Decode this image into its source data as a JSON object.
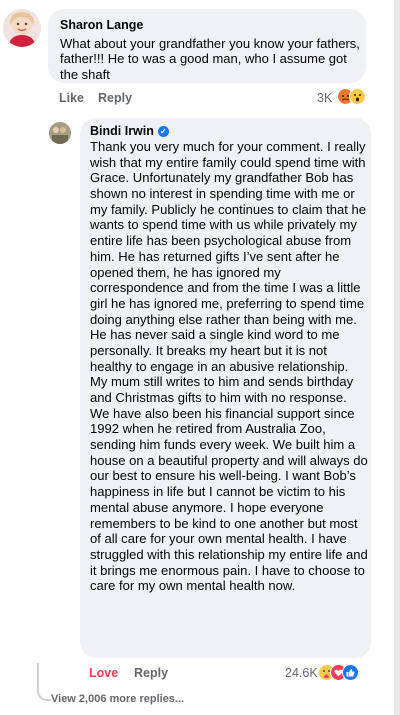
{
  "comments": [
    {
      "author": "Sharon Lange",
      "text": "What about your grandfather you know your fathers, father!!!  He to was a good man,  who I assume got the shaft",
      "actions": {
        "like": "Like",
        "reply": "Reply"
      },
      "reaction_count": "3K",
      "reactions": [
        "angry-reaction-icon",
        "wow-reaction-icon"
      ]
    },
    {
      "author": "Bindi Irwin",
      "verified": true,
      "text": "Thank you very much for your comment. I really wish that my entire family could spend time with Grace. Unfortunately my grandfather Bob has shown no interest in spending time with me or my family. Publicly he continues to claim that he wants to spend time with us while privately my entire life has been psychological abuse from him. He has returned gifts I’ve sent after he opened them, he has ignored my correspondence and from the time I was a little girl he has ignored me, preferring to spend time doing anything else rather than being with me. He has never said a single kind word to me personally. It breaks my heart but it is not healthy to engage in an abusive relationship. My mum still writes to him and sends birthday and Christmas gifts to him with no response. We have also been his financial support since 1992 when he retired from Australia Zoo, sending him funds every week. We built him a house on a beautiful property and will always do our best to ensure his well-being. I want Bob’s happiness in life but I cannot be victim to his mental abuse anymore. I hope everyone remembers to be kind to one another but most of all care for your own mental health. I have struggled with this relationship my entire life and it brings me enormous pain. I have to choose to care for my own mental health now.",
      "actions": {
        "like": "Love",
        "reply": "Reply"
      },
      "reaction_count": "24.6K",
      "reactions": [
        "care-reaction-icon",
        "love-reaction-icon",
        "like-reaction-icon"
      ]
    }
  ],
  "view_more": "View 2,006 more replies...",
  "colors": {
    "love": "#f33e58",
    "secondary_text": "#65676b",
    "bubble": "#eff1f4",
    "verified": "#1877f2"
  }
}
